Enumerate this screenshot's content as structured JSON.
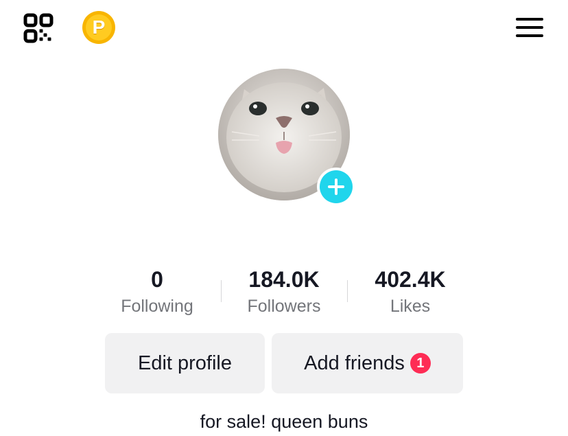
{
  "header": {
    "qr_icon": "qr-code-icon",
    "coin_icon": "coin-icon",
    "coin_letter": "P",
    "menu_icon": "hamburger-menu-icon"
  },
  "profile": {
    "avatar_icon": "cat-avatar",
    "add_icon": "plus-icon",
    "add_color": "#20d5ec"
  },
  "stats": [
    {
      "value": "0",
      "label": "Following"
    },
    {
      "value": "184.0K",
      "label": "Followers"
    },
    {
      "value": "402.4K",
      "label": "Likes"
    }
  ],
  "actions": {
    "edit_profile_label": "Edit profile",
    "add_friends_label": "Add friends",
    "add_friends_badge": "1",
    "badge_color": "#fe2c55"
  },
  "bio": "for sale! queen buns"
}
